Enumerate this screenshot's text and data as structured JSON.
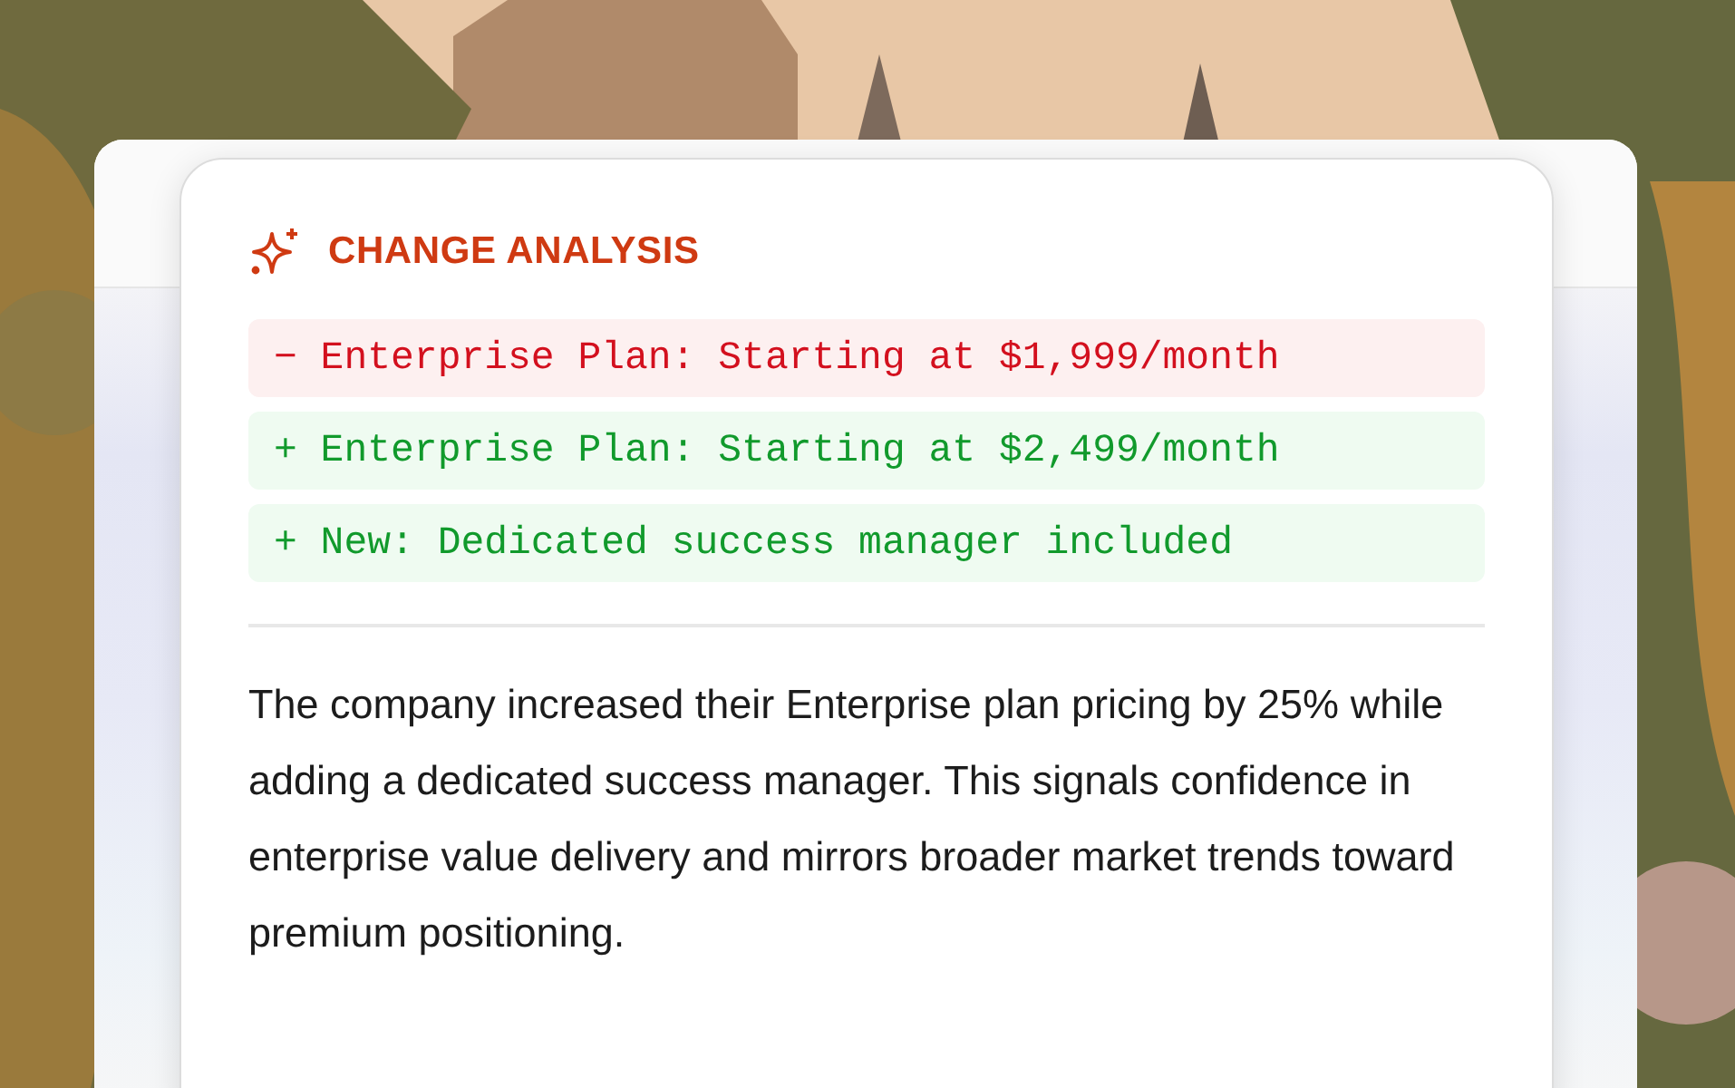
{
  "card": {
    "title": "CHANGE ANALYSIS"
  },
  "changes": [
    {
      "kind": "removed",
      "text": "− Enterprise Plan: Starting at $1,999/month"
    },
    {
      "kind": "added",
      "text": "+ Enterprise Plan: Starting at $2,499/month"
    },
    {
      "kind": "added",
      "text": "+ New: Dedicated success manager included"
    }
  ],
  "summary": "The company increased their Enterprise plan pricing by 25% while adding a dedicated success manager. This signals confidence in enterprise value delivery and mirrors broader market trends toward premium positioning."
}
